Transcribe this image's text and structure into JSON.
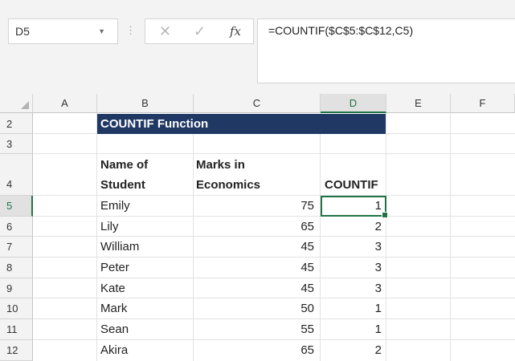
{
  "name_box": {
    "value": "D5"
  },
  "formula_bar": {
    "cancel_glyph": "✕",
    "enter_glyph": "✓",
    "fx_label": "fx",
    "formula": "=COUNTIF($C$5:$C$12,C5)"
  },
  "columns": [
    "A",
    "B",
    "C",
    "D",
    "E",
    "F"
  ],
  "rows": [
    "2",
    "3",
    "4",
    "5",
    "6",
    "7",
    "8",
    "9",
    "10",
    "11",
    "12"
  ],
  "sheet": {
    "title": "COUNTIF Function",
    "headers": {
      "name_line1": "Name of",
      "name_line2": "Student",
      "marks_line1": "Marks in",
      "marks_line2": "Economics",
      "countif": "COUNTIF"
    },
    "data": [
      {
        "name": "Emily",
        "marks": "75",
        "countif": "1"
      },
      {
        "name": "Lily",
        "marks": "65",
        "countif": "2"
      },
      {
        "name": "William",
        "marks": "45",
        "countif": "3"
      },
      {
        "name": "Peter",
        "marks": "45",
        "countif": "3"
      },
      {
        "name": "Kate",
        "marks": "45",
        "countif": "3"
      },
      {
        "name": "Mark",
        "marks": "50",
        "countif": "1"
      },
      {
        "name": "Sean",
        "marks": "55",
        "countif": "1"
      },
      {
        "name": "Akira",
        "marks": "65",
        "countif": "2"
      }
    ]
  },
  "selected_cell": "D5",
  "accent_color": "#217346",
  "title_fill_color": "#1f3864"
}
